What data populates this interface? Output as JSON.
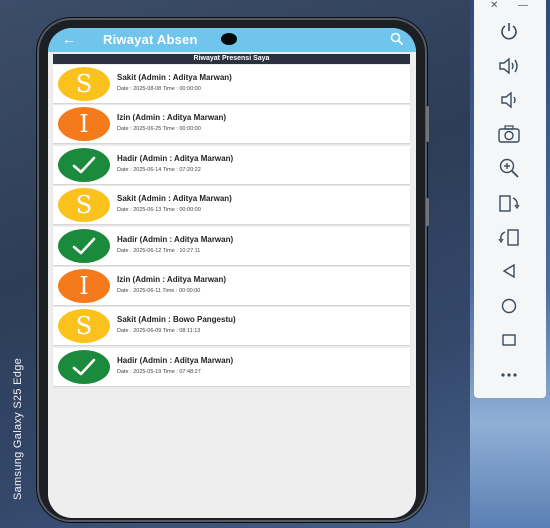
{
  "device": {
    "label": "Samsung Galaxy S25 Edge"
  },
  "appbar": {
    "back_icon": "arrow-left-icon",
    "title": "Riwayat Absen",
    "search_icon": "search-icon"
  },
  "section": {
    "title": "Riwayat Presensi Saya"
  },
  "colors": {
    "sakit": "#fbc11c",
    "izin": "#f57a1c",
    "hadir": "#1c8a3d",
    "appbar": "#6fc5ec"
  },
  "items": [
    {
      "type": "sakit",
      "letter": "S",
      "name": "Sakit (Admin : Aditya Marwan)",
      "meta": "Date : 2025-08-08 Time : 00:00:00"
    },
    {
      "type": "izin",
      "letter": "I",
      "name": "Izin (Admin : Aditya Marwan)",
      "meta": "Date : 2025-06-25 Time : 00:00:00"
    },
    {
      "type": "hadir",
      "letter": "",
      "name": "Hadir (Admin : Aditya Marwan)",
      "meta": "Date : 2025-06-14 Time : 07:20:22"
    },
    {
      "type": "sakit",
      "letter": "S",
      "name": "Sakit (Admin : Aditya Marwan)",
      "meta": "Date : 2025-06-13 Time : 00:00:00"
    },
    {
      "type": "hadir",
      "letter": "",
      "name": "Hadir (Admin : Aditya Marwan)",
      "meta": "Date : 2025-06-12 Time : 10:27:11"
    },
    {
      "type": "izin",
      "letter": "I",
      "name": "Izin (Admin : Aditya Marwan)",
      "meta": "Date : 2025-06-11 Time : 00:00:00"
    },
    {
      "type": "sakit",
      "letter": "S",
      "name": "Sakit (Admin : Bowo Pangestu)",
      "meta": "Date : 2025-06-09 Time : 08:11:13"
    },
    {
      "type": "hadir",
      "letter": "",
      "name": "Hadir (Admin : Aditya Marwan)",
      "meta": "Date : 2025-05-19 Time : 07:48:27"
    }
  ],
  "toolbar": {
    "window_controls": [
      "close-icon",
      "minimize-icon"
    ],
    "tools": [
      "power-icon",
      "volume-up-icon",
      "volume-down-icon",
      "camera-icon",
      "zoom-in-icon",
      "rotate-left-icon",
      "rotate-right-icon",
      "back-icon",
      "home-icon",
      "overview-icon",
      "more-icon"
    ]
  }
}
